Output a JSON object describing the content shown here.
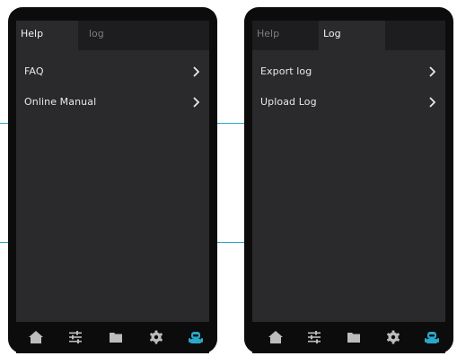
{
  "colors": {
    "accent": "#2aa7c9",
    "device_frame": "#0c0c0c",
    "screen_bg": "#2a2a2c",
    "tabbar_bg": "#1d1d1f",
    "text_primary": "#e9e9e9",
    "text_inactive": "#7d7d7d",
    "nav_icon": "#bdbdbd",
    "nav_icon_active": "#2aa7c9"
  },
  "left_panel": {
    "tabs": [
      {
        "label": "Help",
        "active": true
      },
      {
        "label": "log",
        "active": false
      }
    ],
    "items": [
      {
        "label": "FAQ"
      },
      {
        "label": "Online Manual"
      }
    ],
    "nav": [
      "home-icon",
      "sliders-icon",
      "folder-icon",
      "gear-icon",
      "robot-icon"
    ],
    "nav_active": "robot-icon"
  },
  "right_panel": {
    "tabs": [
      {
        "label": "Help",
        "active": false
      },
      {
        "label": "Log",
        "active": true
      }
    ],
    "items": [
      {
        "label": "Export log"
      },
      {
        "label": "Upload Log"
      }
    ],
    "nav": [
      "home-icon",
      "sliders-icon",
      "folder-icon",
      "gear-icon",
      "robot-icon"
    ],
    "nav_active": "robot-icon"
  }
}
